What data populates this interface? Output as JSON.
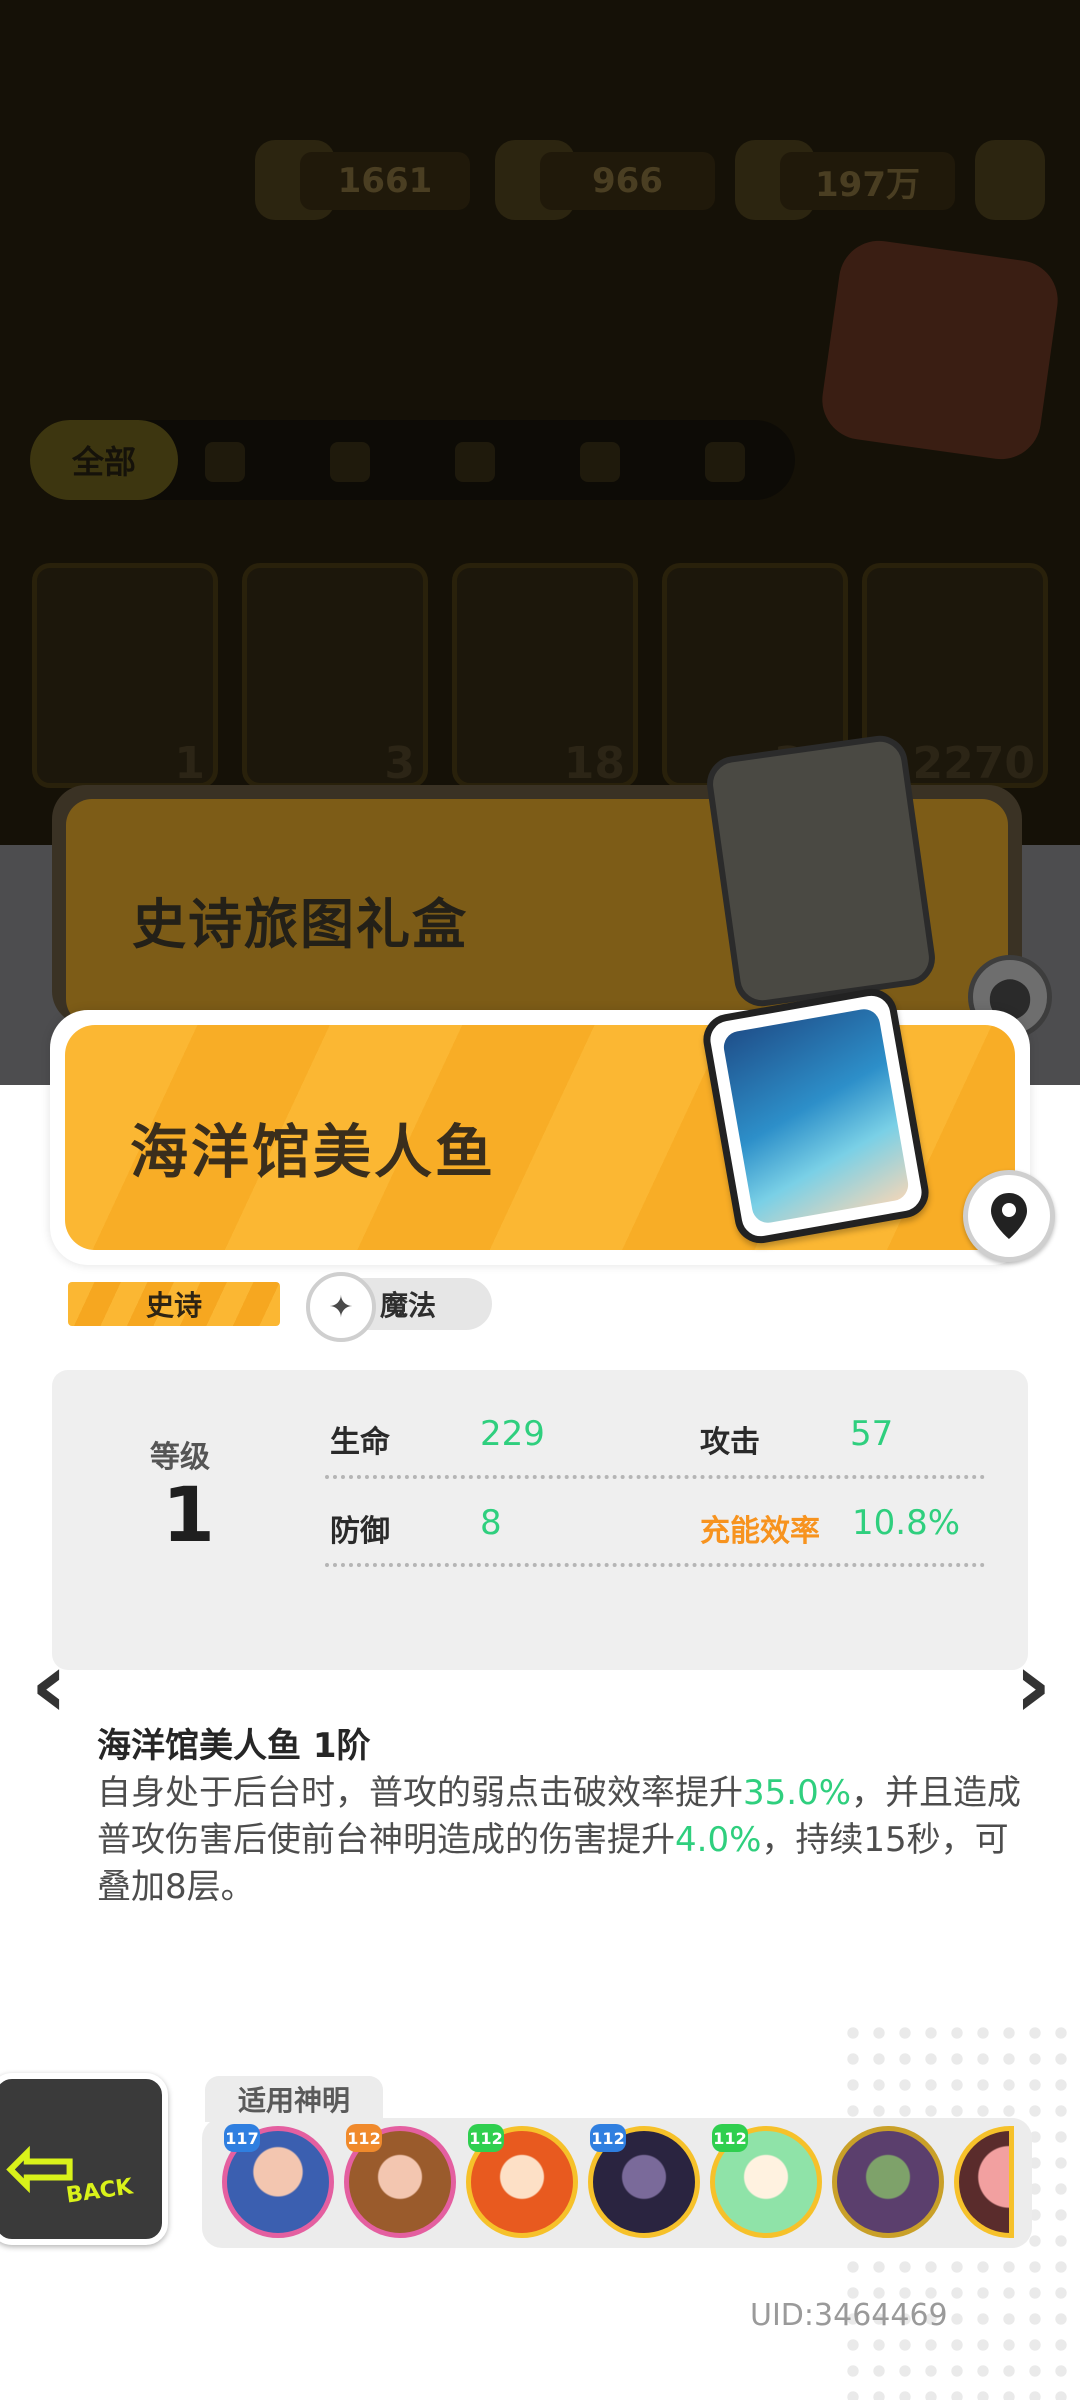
{
  "resources": [
    {
      "icon": "trophy-icon",
      "value": "1661"
    },
    {
      "icon": "diamond-icon",
      "value": "966"
    },
    {
      "icon": "cash-icon",
      "value": "197万"
    }
  ],
  "filters": {
    "all_label": "全部"
  },
  "inventory_counts": [
    "1",
    "3",
    "18",
    "37",
    "2270"
  ],
  "gift_box": {
    "title": "史诗旅图礼盒"
  },
  "card": {
    "name": "海洋馆美人鱼",
    "rarity": "史诗",
    "type": "魔法"
  },
  "stats": {
    "level_label": "等级",
    "level": "1",
    "hp_label": "生命",
    "hp": "229",
    "atk_label": "攻击",
    "atk": "57",
    "def_label": "防御",
    "def": "8",
    "energy_label": "充能效率",
    "energy": "10.8%"
  },
  "description": {
    "title": "海洋馆美人鱼 1阶",
    "part1": "自身处于后台时，普攻的弱点击破效率提升",
    "hl1": "35.0%",
    "part2": "，并且造成普攻伤害后使前台神明造成的伤害提升",
    "hl2": "4.0%",
    "part3": "，持续15秒，可叠加8层。"
  },
  "back_button": {
    "label": "BACK"
  },
  "applicable_gods": {
    "label": "适用神明",
    "levels": [
      "117",
      "112",
      "112",
      "112",
      "112"
    ]
  },
  "uid": "UID:3464469",
  "colors": {
    "accent": "#fbb733",
    "stat_value": "#2fcf7e",
    "special": "#f7931e"
  }
}
